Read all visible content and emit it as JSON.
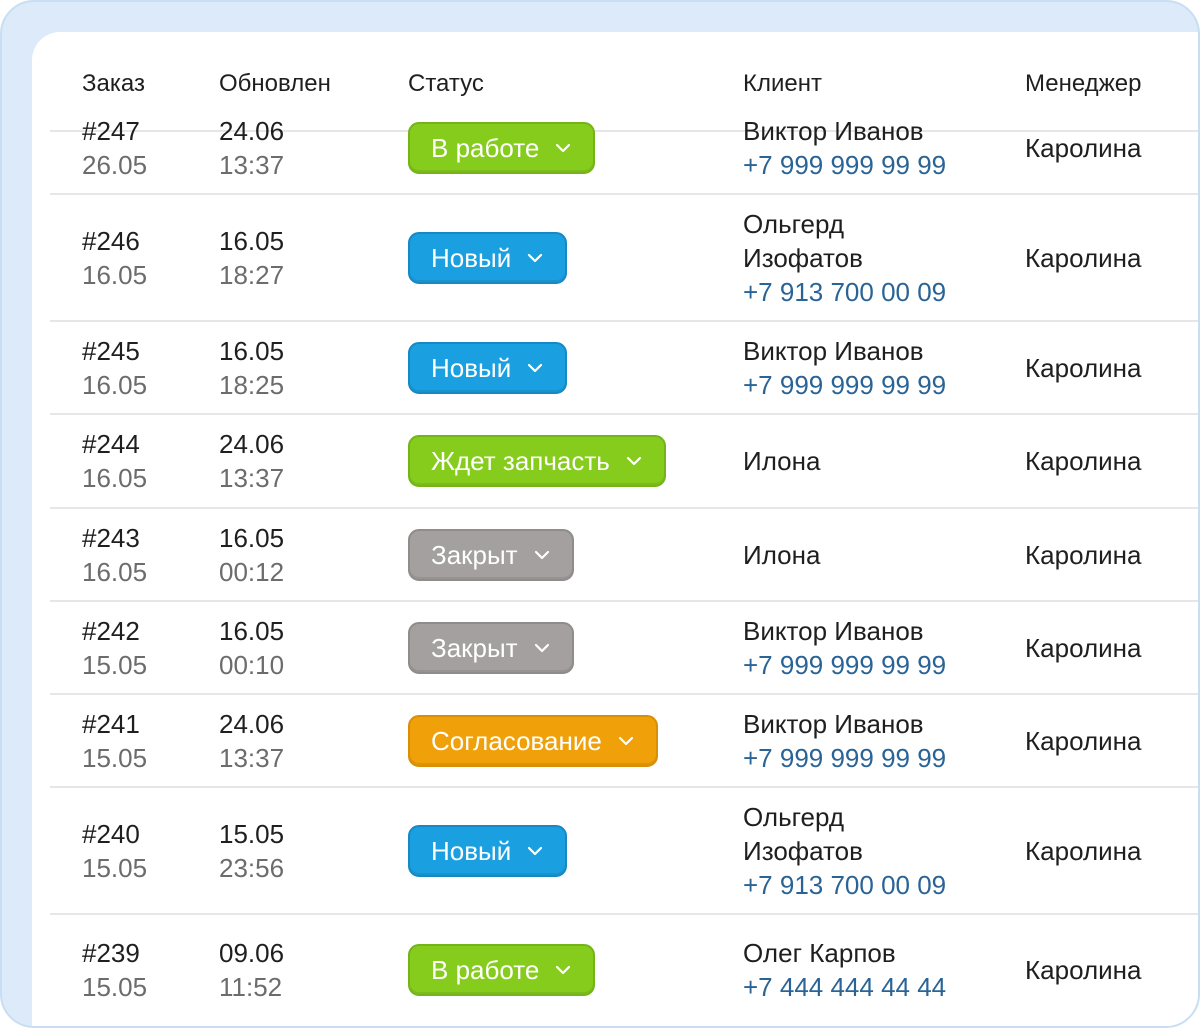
{
  "columns": {
    "order": "Заказ",
    "updated": "Обновлен",
    "status": "Статус",
    "client": "Клиент",
    "manager": "Менеджер"
  },
  "status_colors": {
    "green": "#86cc1d",
    "blue": "#1aa0e0",
    "gray": "#a3a09f",
    "orange": "#f0a008"
  },
  "rows": [
    {
      "order": "#247",
      "created": "26.05",
      "updated_date": "24.06",
      "updated_time": "13:37",
      "status": "В работе",
      "status_color": "green",
      "client_name": [
        "Виктор Иванов"
      ],
      "client_phone": "+7 999 999 99 99",
      "manager": "Каролина"
    },
    {
      "order": "#246",
      "created": "16.05",
      "updated_date": "16.05",
      "updated_time": "18:27",
      "status": "Новый",
      "status_color": "blue",
      "client_name": [
        "Ольгерд",
        "Изофатов"
      ],
      "client_phone": "+7 913 700 00 09",
      "manager": "Каролина"
    },
    {
      "order": "#245",
      "created": "16.05",
      "updated_date": "16.05",
      "updated_time": "18:25",
      "status": "Новый",
      "status_color": "blue",
      "client_name": [
        "Виктор Иванов"
      ],
      "client_phone": "+7 999 999 99 99",
      "manager": "Каролина"
    },
    {
      "order": "#244",
      "created": "16.05",
      "updated_date": "24.06",
      "updated_time": "13:37",
      "status": "Ждет запчасть",
      "status_color": "green",
      "client_name": [
        "Илона"
      ],
      "client_phone": "",
      "manager": "Каролина"
    },
    {
      "order": "#243",
      "created": "16.05",
      "updated_date": "16.05",
      "updated_time": "00:12",
      "status": "Закрыт",
      "status_color": "gray",
      "client_name": [
        "Илона"
      ],
      "client_phone": "",
      "manager": "Каролина"
    },
    {
      "order": "#242",
      "created": "15.05",
      "updated_date": "16.05",
      "updated_time": "00:10",
      "status": "Закрыт",
      "status_color": "gray",
      "client_name": [
        "Виктор Иванов"
      ],
      "client_phone": "+7 999 999 99 99",
      "manager": "Каролина"
    },
    {
      "order": "#241",
      "created": "15.05",
      "updated_date": "24.06",
      "updated_time": "13:37",
      "status": "Согласование",
      "status_color": "orange",
      "client_name": [
        "Виктор Иванов"
      ],
      "client_phone": "+7 999 999 99 99",
      "manager": "Каролина"
    },
    {
      "order": "#240",
      "created": "15.05",
      "updated_date": "15.05",
      "updated_time": "23:56",
      "status": "Новый",
      "status_color": "blue",
      "client_name": [
        "Ольгерд",
        "Изофатов"
      ],
      "client_phone": "+7 913 700 00 09",
      "manager": "Каролина"
    },
    {
      "order": "#239",
      "created": "15.05",
      "updated_date": "09.06",
      "updated_time": "11:52",
      "status": "В работе",
      "status_color": "green",
      "client_name": [
        "Олег Карпов"
      ],
      "client_phone": "+7 444 444 44 44",
      "manager": "Каролина"
    }
  ]
}
